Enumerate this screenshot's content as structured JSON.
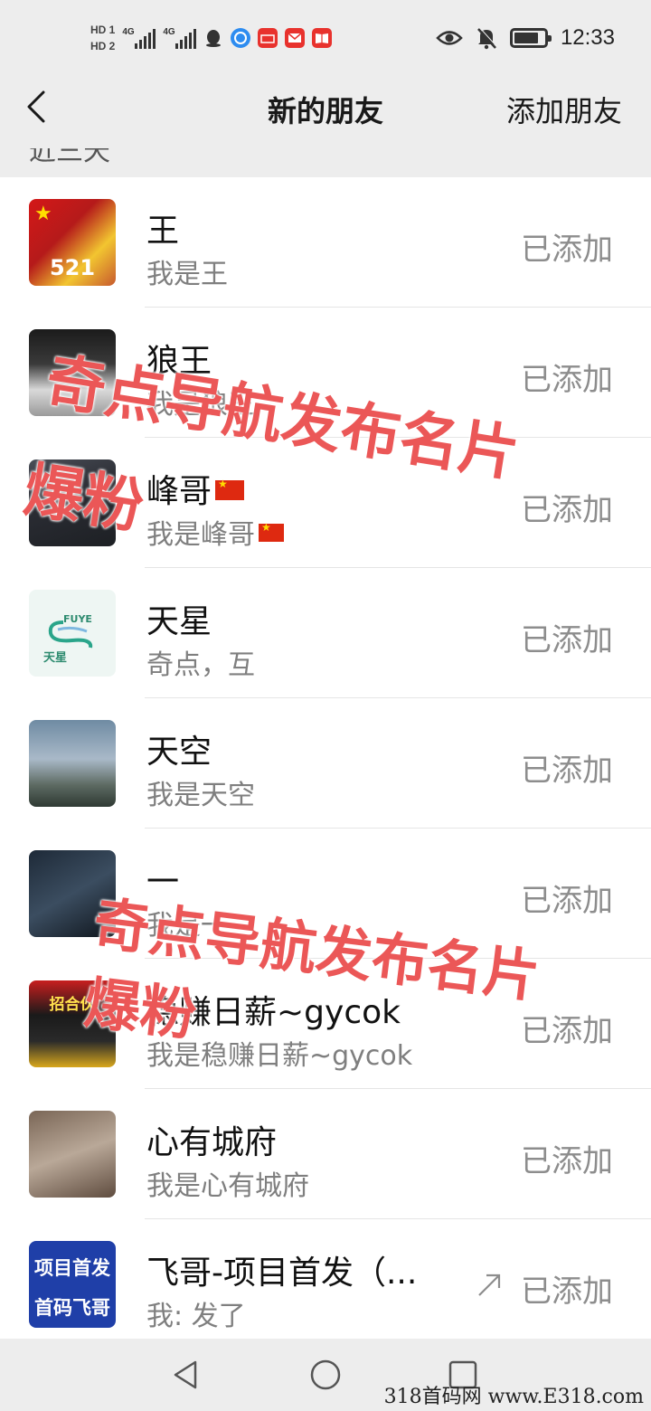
{
  "status_bar": {
    "hd1": "HD 1",
    "hd2": "HD 2",
    "net1": "4G",
    "net2": "4G",
    "time": "12:33",
    "battery_level": 0.8
  },
  "nav": {
    "title": "新的朋友",
    "action": "添加朋友"
  },
  "partial_section_header": "近三天",
  "friends": [
    {
      "name": "王",
      "message": "我是王",
      "status": "已添加"
    },
    {
      "name": "狼王",
      "message": "我是狼王",
      "status": "已添加"
    },
    {
      "name": "峰哥",
      "message": "我是峰哥",
      "status": "已添加"
    },
    {
      "name": "天星",
      "message": "奇点，互",
      "status": "已添加"
    },
    {
      "name": "天空",
      "message": "我是天空",
      "status": "已添加"
    },
    {
      "name": "一",
      "message": "我是一",
      "status": "已添加"
    },
    {
      "name": "稳赚日薪~gycok",
      "message": "我是稳赚日薪~gycok",
      "status": "已添加"
    },
    {
      "name": "心有城府",
      "message": "我是心有城府",
      "status": "已添加"
    },
    {
      "name": "飞哥-项目首发（...",
      "message": "我: 发了",
      "status": "已添加"
    }
  ],
  "avatar_text": {
    "wang": "521",
    "tianxing_brand": "FUYE",
    "tianxing_name": "天星",
    "recruit": "招合伙",
    "feige_top": "项目首发",
    "feige_bottom": "首码飞哥"
  },
  "watermarks": {
    "line1": "奇点导航发布名片",
    "line2": "爆粉"
  },
  "site_watermark": "318首码网  www.E318.com"
}
